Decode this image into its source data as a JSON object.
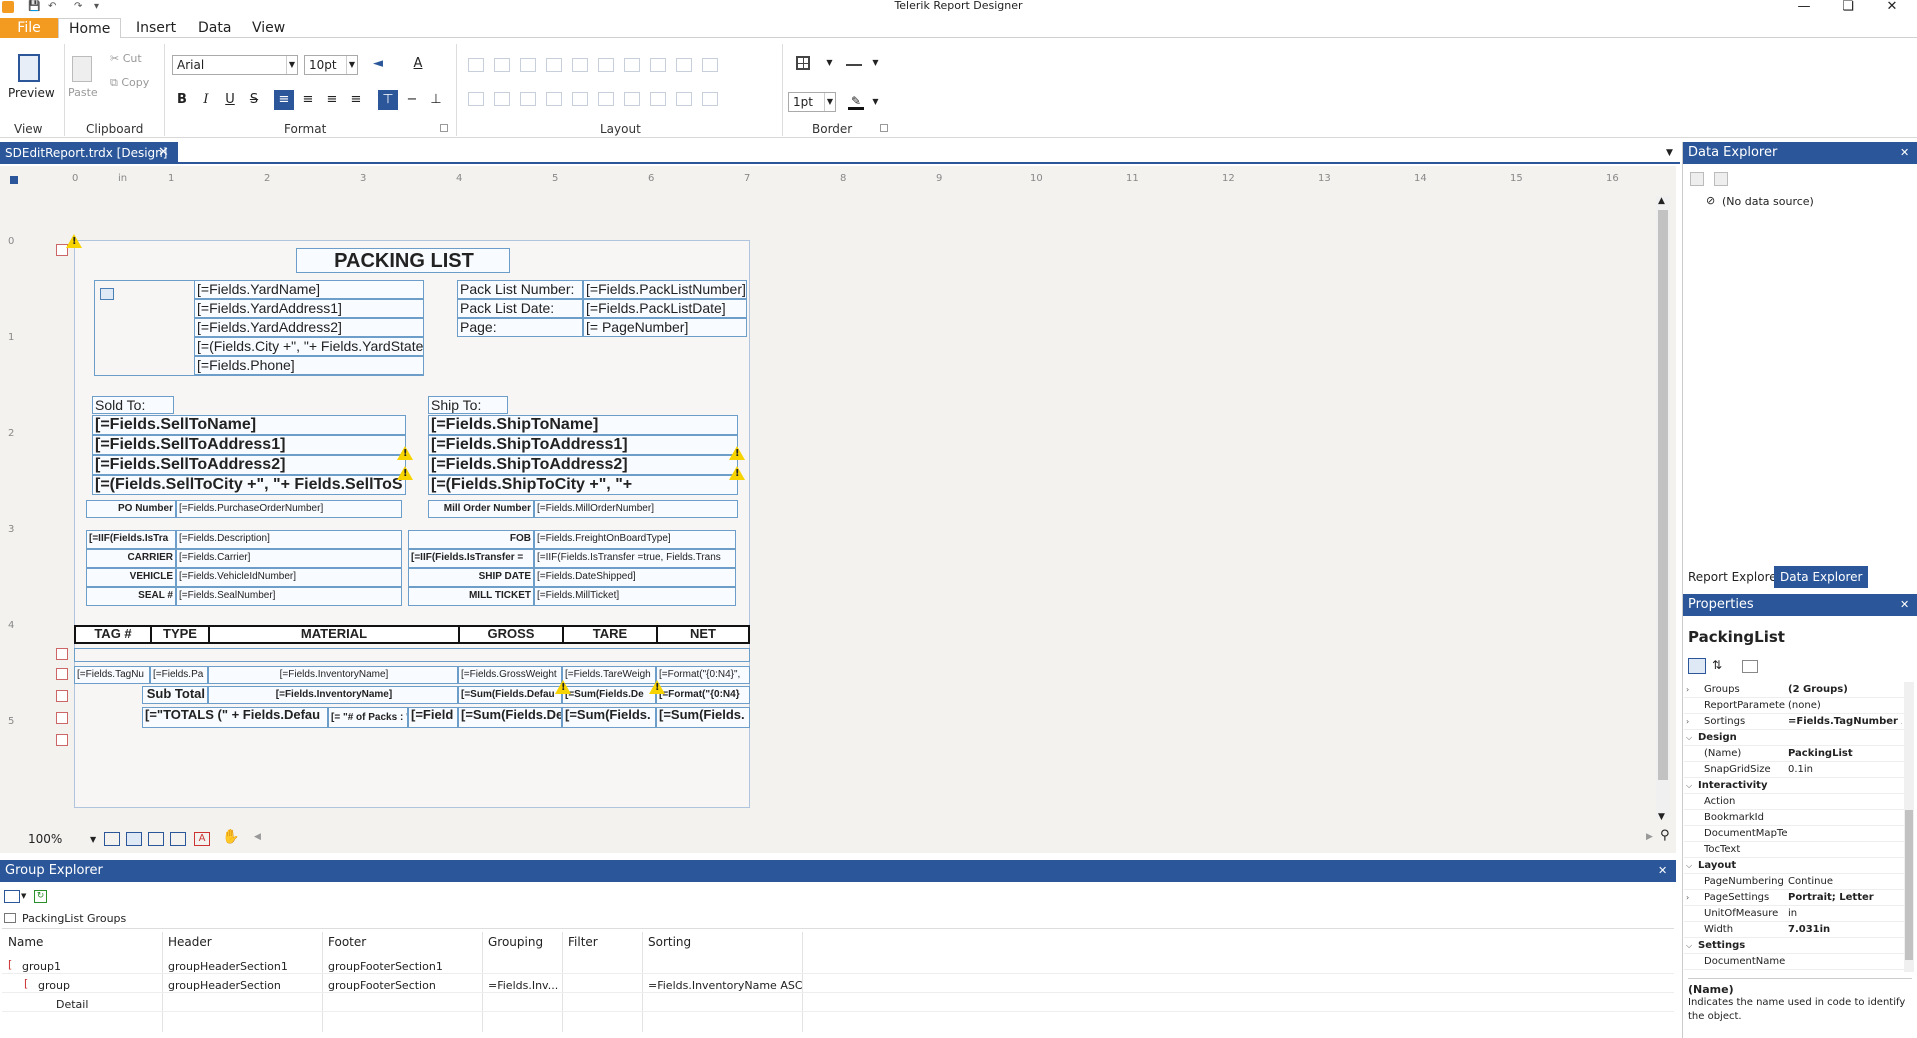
{
  "app": {
    "title": "Telerik Report Designer"
  },
  "ribbon": {
    "tabs": [
      "File",
      "Home",
      "Insert",
      "Data",
      "View"
    ],
    "preview_label": "Preview",
    "paste_label": "Paste",
    "cut_label": "Cut",
    "copy_label": "Copy",
    "font_name": "Arial",
    "font_size": "10pt",
    "border_width": "1pt",
    "groups": {
      "view": "View",
      "clipboard": "Clipboard",
      "format": "Format",
      "layout": "Layout",
      "border": "Border"
    }
  },
  "document_tab": {
    "label": "SDEditReport.trdx [Design]"
  },
  "ruler": {
    "unit": "in",
    "h_ticks": [
      "0",
      "1",
      "2",
      "3",
      "4",
      "5",
      "6",
      "7",
      "8",
      "9",
      "10",
      "11",
      "12",
      "13",
      "14",
      "15",
      "16"
    ],
    "v_ticks": [
      "0",
      "1",
      "2",
      "3",
      "4",
      "5"
    ]
  },
  "report": {
    "title": "PACKING LIST",
    "yard": [
      "[=Fields.YardName]",
      "[=Fields.YardAddress1]",
      "[=Fields.YardAddress2]",
      "[=(Fields.City +\", \"+ Fields.YardState +",
      "[=Fields.Phone]"
    ],
    "packlist_labels": [
      "Pack List Number:",
      "Pack List Date:",
      "Page:"
    ],
    "packlist_values": [
      "[=Fields.PackListNumber]",
      "[=Fields.PackListDate]",
      "[= PageNumber]"
    ],
    "sold_to_label": "Sold To:",
    "ship_to_label": "Ship To:",
    "sold": [
      "[=Fields.SellToName]",
      "[=Fields.SellToAddress1]",
      "[=Fields.SellToAddress2]",
      "[=(Fields.SellToCity +\", \"+ Fields.SellToS"
    ],
    "ship": [
      "[=Fields.ShipToName]",
      "[=Fields.ShipToAddress1]",
      "[=Fields.ShipToAddress2]",
      "[=(Fields.ShipToCity +\", \"+"
    ],
    "po_label": "PO Number",
    "po_value": "[=Fields.PurchaseOrderNumber]",
    "mill_order_label": "Mill Order Number",
    "mill_order_value": "[=Fields.MillOrderNumber]",
    "left_labels": [
      "[=IIF(Fields.IsTra",
      "CARRIER",
      "VEHICLE",
      "SEAL #"
    ],
    "left_values": [
      "[=Fields.Description]",
      "[=Fields.Carrier]",
      "[=Fields.VehicleIdNumber]",
      "[=Fields.SealNumber]"
    ],
    "right_labels": [
      "FOB",
      "[=IIF(Fields.IsTransfer =",
      "SHIP DATE",
      "MILL TICKET"
    ],
    "right_values": [
      "[=Fields.FreightOnBoardType]",
      "[=IIF(Fields.IsTransfer =true, Fields.Trans",
      "[=Fields.DateShipped]",
      "[=Fields.MillTicket]"
    ],
    "columns": [
      "TAG #",
      "TYPE",
      "MATERIAL",
      "GROSS",
      "TARE",
      "NET"
    ],
    "detail": [
      "[=Fields.TagNu",
      "[=Fields.Pa",
      "[=Fields.InventoryName]",
      "[=Fields.GrossWeight",
      "[=Fields.TareWeigh",
      "[=Format(\"{0:N4}\","
    ],
    "subtotal": [
      "Sub Total",
      "[=Fields.InventoryName]",
      "[=Sum(Fields.Defau",
      "[=Sum(Fields.De",
      "[=Format(\"{0:N4}"
    ],
    "totals": [
      "[=\"TOTALS (\" + Fields.Defau",
      "[= \"# of Packs : \"",
      "[=Field",
      "[=Sum(Fields.De",
      "[=Sum(Fields.",
      "[=Sum(Fields."
    ]
  },
  "zoom": {
    "value": "100%"
  },
  "data_explorer": {
    "title": "Data Explorer",
    "no_source": "(No data source)",
    "tabs": [
      "Report Explorer",
      "Data Explorer"
    ]
  },
  "properties": {
    "title": "Properties",
    "object": "PackingList",
    "rows": [
      {
        "name": "Groups",
        "value": "(2 Groups)",
        "bold": true
      },
      {
        "name": "ReportParamete",
        "value": "(none)"
      },
      {
        "name": "Sortings",
        "value": "=Fields.TagNumber A",
        "bold": true
      },
      {
        "name": "Design",
        "value": "",
        "cat": true
      },
      {
        "name": "(Name)",
        "value": "PackingList",
        "bold": true
      },
      {
        "name": "SnapGridSize",
        "value": "0.1in"
      },
      {
        "name": "Interactivity",
        "value": "",
        "cat": true
      },
      {
        "name": "Action",
        "value": ""
      },
      {
        "name": "BookmarkId",
        "value": ""
      },
      {
        "name": "DocumentMapTe",
        "value": ""
      },
      {
        "name": "TocText",
        "value": ""
      },
      {
        "name": "Layout",
        "value": "",
        "cat": true
      },
      {
        "name": "PageNumbering",
        "value": "Continue"
      },
      {
        "name": "PageSettings",
        "value": "Portrait; Letter",
        "bold": true
      },
      {
        "name": "UnitOfMeasure",
        "value": "in"
      },
      {
        "name": "Width",
        "value": "7.031in",
        "bold": true
      },
      {
        "name": "Settings",
        "value": "",
        "cat": true
      },
      {
        "name": "DocumentName",
        "value": ""
      }
    ],
    "desc_title": "(Name)",
    "desc_text": "Indicates the name used in code to identify the object."
  },
  "group_explorer": {
    "title": "Group Explorer",
    "root": "PackingList Groups",
    "columns": [
      "Name",
      "Header",
      "Footer",
      "Grouping",
      "Filter",
      "Sorting"
    ],
    "rows": [
      {
        "name": "group1",
        "header": "groupHeaderSection1",
        "footer": "groupFooterSection1",
        "grouping": "",
        "filter": "",
        "sorting": ""
      },
      {
        "name": "group",
        "header": "groupHeaderSection",
        "footer": "groupFooterSection",
        "grouping": "=Fields.Inv...",
        "filter": "",
        "sorting": "=Fields.InventoryName ASC"
      },
      {
        "name": "Detail",
        "header": "",
        "footer": "",
        "grouping": "",
        "filter": "",
        "sorting": ""
      }
    ]
  },
  "colors": {
    "accent": "#2b579a",
    "file_tab": "#f39a21",
    "warning": "#f7d300"
  }
}
